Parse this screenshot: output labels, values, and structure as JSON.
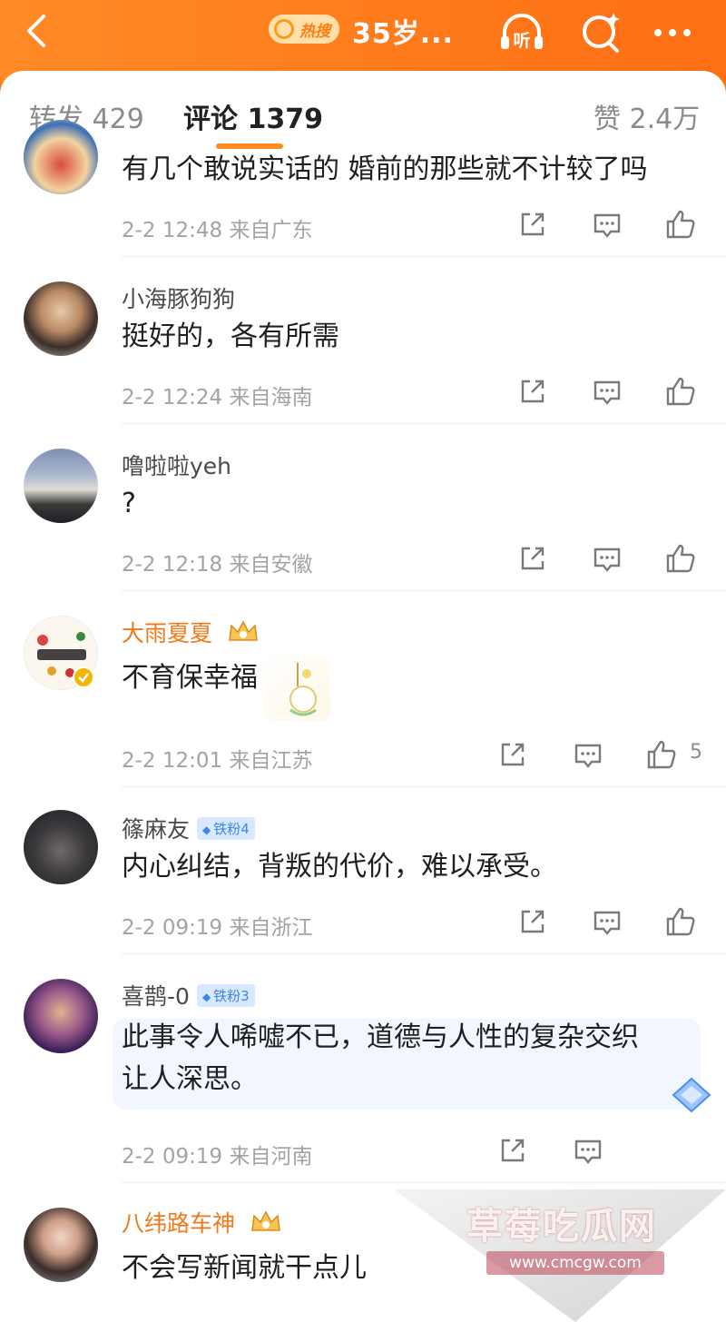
{
  "header": {
    "hot_label": "热搜",
    "title": "35岁...",
    "listen_label": "听"
  },
  "tabs": [
    {
      "label": "转发 429"
    },
    {
      "label": "评论 1379"
    },
    {
      "label": "赞 2.4万"
    }
  ],
  "comments": [
    {
      "name": "",
      "text": "有几个敢说实话的  婚前的那些就不计较了吗",
      "time": "2-2 12:48",
      "location": "来自广东",
      "likes": ""
    },
    {
      "name": "小海豚狗狗",
      "text": "挺好的，各有所需",
      "time": "2-2 12:24",
      "location": "来自海南",
      "likes": ""
    },
    {
      "name": "噜啦啦yeh",
      "text": "?",
      "time": "2-2 12:18",
      "location": "来自安徽",
      "likes": ""
    },
    {
      "name": "大雨夏夏",
      "text": "不育保幸福",
      "time": "2-2 12:01",
      "location": "来自江苏",
      "likes": "5"
    },
    {
      "name": "篠麻友",
      "badge": "铁粉4",
      "text": "内心纠结，背叛的代价，难以承受。",
      "time": "2-2 09:19",
      "location": "来自浙江",
      "likes": ""
    },
    {
      "name": "喜鹊-0",
      "badge": "铁粉3",
      "text_line1": "此事令人唏嘘不已，道德与人性的复杂交织",
      "text_line2": "让人深思。",
      "time": "2-2 09:19",
      "location": "来自河南",
      "likes": ""
    },
    {
      "name": "八纬路车神",
      "text": "不会写新闻就干点儿",
      "time": "",
      "location": "",
      "likes": ""
    }
  ],
  "watermark": {
    "title": "草莓吃瓜网",
    "url": "www.cmcgw.com"
  },
  "colors": {
    "brand_orange": "#ff7a1f",
    "tab_underline": "#ff8a1e",
    "vip_name": "#ee7a1a",
    "fan_badge": "#3f86e0"
  }
}
